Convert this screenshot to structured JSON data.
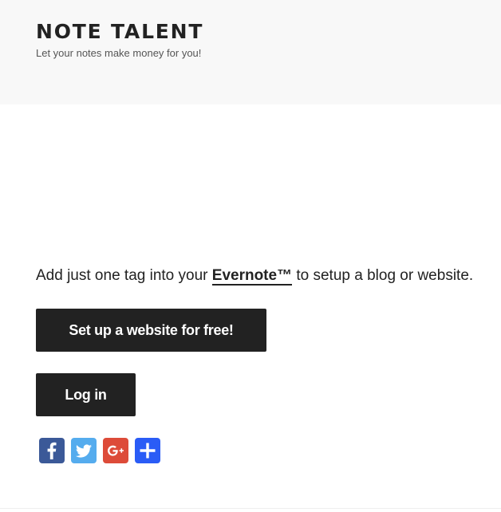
{
  "header": {
    "site_title": "NOTE TALENT",
    "tagline": "Let your notes make money for you!"
  },
  "intro": {
    "before": "Add just one tag into your ",
    "link_text": "Evernote™",
    "after": " to setup a blog or website."
  },
  "actions": {
    "signup_label": "Set up a website for free!",
    "login_label": "Log in"
  },
  "share": {
    "buttons": [
      {
        "icon": "facebook-icon",
        "color": "#3b5998"
      },
      {
        "icon": "twitter-icon",
        "color": "#55acee"
      },
      {
        "icon": "google-plus-icon",
        "color": "#dd4b39"
      },
      {
        "icon": "share-plus-icon",
        "color": "#2a5cf6"
      }
    ]
  },
  "colors": {
    "header_bg": "#f8f8f8",
    "button_bg": "#222222",
    "text": "#222222"
  }
}
